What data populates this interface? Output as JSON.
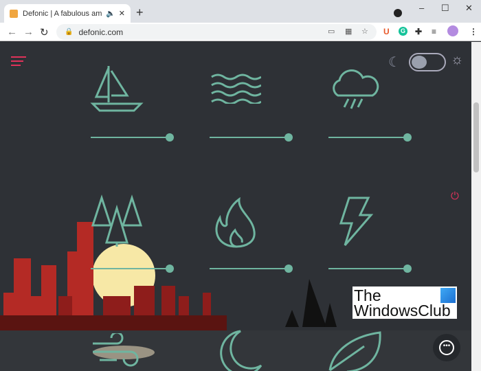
{
  "browser": {
    "tab_title": "Defonic | A fabulous ambient",
    "new_tab": "+",
    "url": "defonic.com",
    "window": {
      "minimize": "–",
      "maximize": "☐",
      "close": "✕"
    },
    "extensions": [
      "U",
      "G"
    ]
  },
  "app": {
    "theme": "dark",
    "accent": "#6fb5a0",
    "menu_color": "#e0325a",
    "sounds": [
      {
        "name": "sailboat",
        "volume": 1.0
      },
      {
        "name": "waves",
        "volume": 1.0
      },
      {
        "name": "rain",
        "volume": 1.0
      },
      {
        "name": "forest",
        "volume": 1.0
      },
      {
        "name": "fire",
        "volume": 1.0
      },
      {
        "name": "thunder",
        "volume": 1.0
      },
      {
        "name": "wind"
      },
      {
        "name": "night"
      },
      {
        "name": "leaf"
      }
    ],
    "watermark": {
      "line1": "The",
      "line2": "WindowsClub"
    }
  }
}
